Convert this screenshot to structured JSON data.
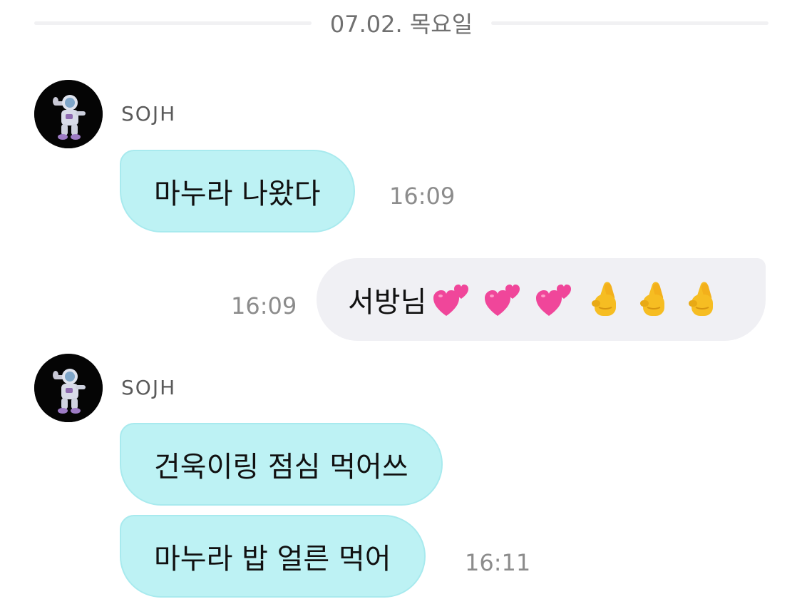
{
  "date_divider": "07.02. 목요일",
  "messages": [
    {
      "sender": "SOJH",
      "text": "마누라 나왔다",
      "time": "16:09"
    },
    {
      "text": "서방님",
      "time": "16:09",
      "emojis": [
        "two-hearts",
        "two-hearts",
        "two-hearts",
        "hand-with-index-and-middle-fingers-crossed",
        "hand-with-index-and-middle-fingers-crossed",
        "hand-with-index-and-middle-fingers-crossed"
      ]
    },
    {
      "sender": "SOJH",
      "text": "건욱이링 점심 먹어쓰"
    },
    {
      "text": "마누라 밥 얼른 먹어",
      "time": "16:11"
    }
  ],
  "colors": {
    "incoming_bubble": "#bdf2f4",
    "outgoing_bubble": "#f0f0f4",
    "timestamp": "#8c8c8c",
    "sender_name": "#5a5a5a",
    "heart": "#f0469a",
    "hand": "#f6bd22"
  }
}
